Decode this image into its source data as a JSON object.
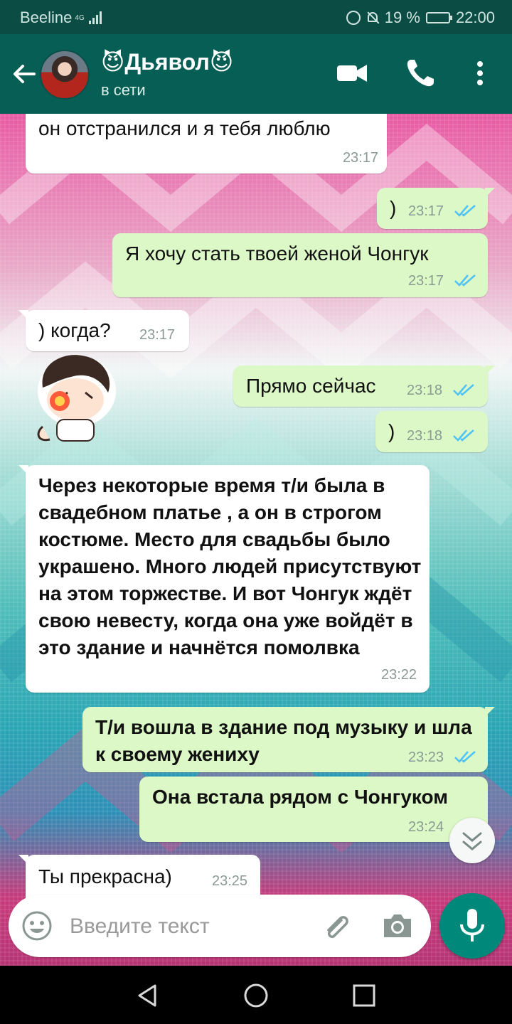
{
  "status_bar": {
    "carrier": "Beeline",
    "network": "4G",
    "battery": "19 %",
    "time": "22:00"
  },
  "header": {
    "contact_name": "😈Дьявол😈",
    "contact_status": "в сети",
    "icons": [
      "back-arrow-icon",
      "avatar",
      "video-camera-icon",
      "phone-icon",
      "more-vert-icon"
    ]
  },
  "messages": [
    {
      "side": "in",
      "text": "он отстранился и я тебя люблю",
      "time": "23:17"
    },
    {
      "side": "out",
      "text": ")",
      "time": "23:17",
      "read": true
    },
    {
      "side": "out",
      "text": "Я хочу стать твоей женой Чонгук",
      "time": "23:17",
      "read": true
    },
    {
      "side": "in",
      "text": ") когда?",
      "time": "23:17"
    },
    {
      "side": "in",
      "type": "sticker",
      "sticker": "chibi-boy-sticker"
    },
    {
      "side": "out",
      "text": "Прямо сейчас",
      "time": "23:18",
      "read": true
    },
    {
      "side": "out",
      "text": ")",
      "time": "23:18",
      "read": true
    },
    {
      "side": "in",
      "text": "Через некоторые время т/и была в свадебном платье , а он в строгом костюме. Место для свадьбы было украшено. Много людей присутствуют на этом торжестве. И вот Чонгук ждёт свою невесту, когда она уже войдёт в это здание и начнётся помолвка",
      "time": "23:22"
    },
    {
      "side": "out",
      "text": "Т/и вошла в здание под музыку и шла к своему жениху",
      "time": "23:23",
      "read": true
    },
    {
      "side": "out",
      "text": "Она встала рядом с Чонгуком",
      "time": "23:24",
      "read": true
    },
    {
      "side": "in",
      "text": "Ты прекрасна)",
      "time": "23:25"
    }
  ],
  "composer": {
    "placeholder": "Введите текст",
    "icons": [
      "emoji-icon",
      "paperclip-icon",
      "camera-icon",
      "microphone-icon"
    ]
  },
  "nav_bar": {
    "icons": [
      "back-triangle-icon",
      "home-circle-icon",
      "recents-square-icon"
    ]
  },
  "colors": {
    "header": "#075e54",
    "status_bar": "#0b4d45",
    "outgoing_bubble": "#dcf8c6",
    "incoming_bubble": "#ffffff",
    "read_ticks": "#4fc3f7",
    "mic_button": "#00897b"
  }
}
